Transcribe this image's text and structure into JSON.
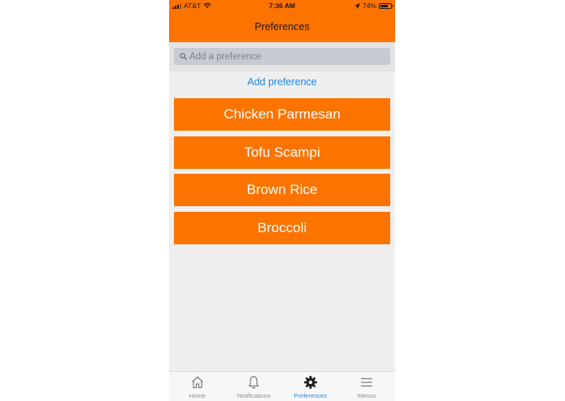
{
  "status_bar": {
    "carrier": "AT&T",
    "time": "7:36 AM",
    "battery_percent": "74%",
    "battery_level": 0.74
  },
  "header": {
    "title": "Preferences",
    "background_color": "#fd7300"
  },
  "search": {
    "placeholder": "Add a preference",
    "value": ""
  },
  "add_link": {
    "label": "Add preference",
    "color": "#1e88e5"
  },
  "preferences": [
    {
      "label": "Chicken Parmesan"
    },
    {
      "label": "Tofu Scampi"
    },
    {
      "label": "Brown Rice"
    },
    {
      "label": "Broccoli"
    }
  ],
  "tabbar": {
    "active_tab": "Preferences",
    "tabs": [
      {
        "label": "Home",
        "icon": "home-icon"
      },
      {
        "label": "Notifications",
        "icon": "bell-icon"
      },
      {
        "label": "Preferences",
        "icon": "gear-icon"
      },
      {
        "label": "Menus",
        "icon": "menu-icon"
      }
    ]
  }
}
